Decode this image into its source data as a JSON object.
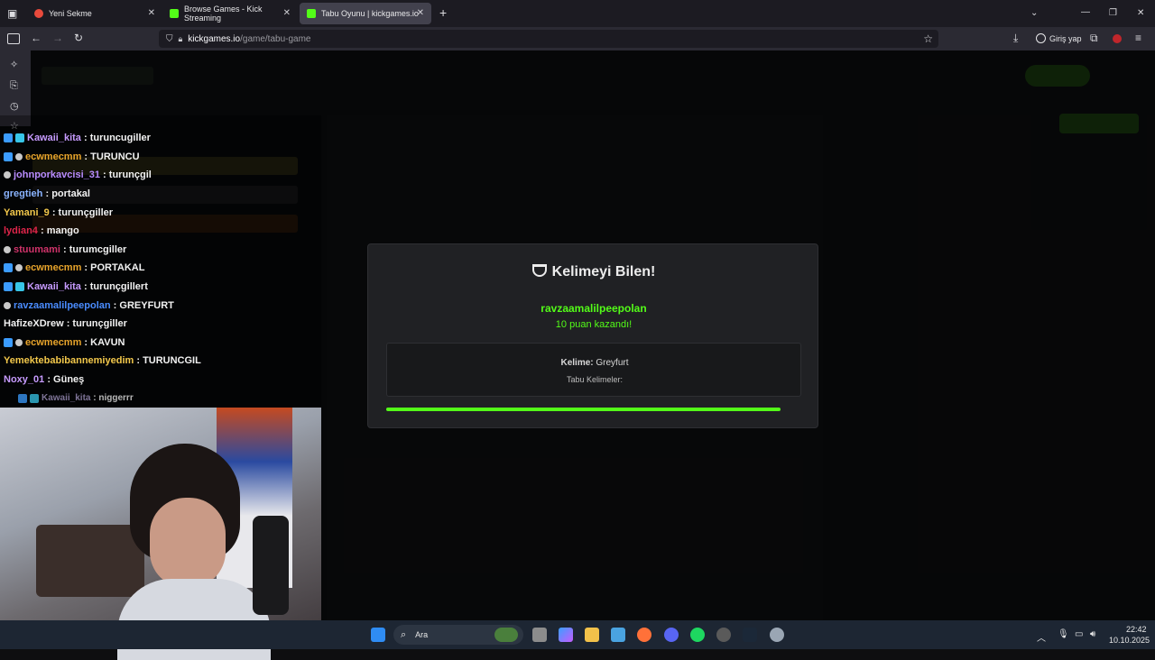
{
  "browser": {
    "tabs": [
      {
        "title": "Yeni Sekme",
        "active": false,
        "favicon_color": "#e84a3c"
      },
      {
        "title": "Browse Games - Kick Streaming",
        "active": false,
        "favicon_color": "#53fc18"
      },
      {
        "title": "Tabu Oyunu | kickgames.io",
        "active": true,
        "favicon_color": "#53fc18"
      }
    ],
    "url_host": "kickgames.io",
    "url_path": "/game/tabu-game",
    "signin_label": "Giriş yap"
  },
  "chat": {
    "messages": [
      {
        "user": "Kawaii_kita",
        "text": "turuncugiller",
        "color": "#c79bff",
        "badges": [
          "blue",
          "cube"
        ]
      },
      {
        "user": "ecwmecmm",
        "text": "TURUNCU",
        "color": "#e8a42b",
        "badges": [
          "blue",
          "gear"
        ]
      },
      {
        "user": "johnporkavcisi_31",
        "text": "turunçgil",
        "color": "#b98cff",
        "badges": [
          "gear"
        ]
      },
      {
        "user": "gregtieh",
        "text": "portakal",
        "color": "#8ab4ff",
        "badges": []
      },
      {
        "user": "Yamani_9",
        "text": "turunçgiller",
        "color": "#f3c84b",
        "badges": []
      },
      {
        "user": "lydian4",
        "text": "mango",
        "color": "#e0254a",
        "badges": []
      },
      {
        "user": "stuumami",
        "text": "turumcgiller",
        "color": "#d0336a",
        "badges": [
          "gear"
        ]
      },
      {
        "user": "ecwmecmm",
        "text": "PORTAKAL",
        "color": "#e8a42b",
        "badges": [
          "blue",
          "gear"
        ]
      },
      {
        "user": "Kawaii_kita",
        "text": "turunçgillert",
        "color": "#c79bff",
        "badges": [
          "blue",
          "cube"
        ]
      },
      {
        "user": "ravzaamalilpeepolan",
        "text": "GREYFURT",
        "color": "#4a8cff",
        "badges": [
          "gear"
        ]
      },
      {
        "user": "HafizeXDrew",
        "text": "turunçgiller",
        "color": "#f2f2f2",
        "badges": []
      },
      {
        "user": "ecwmecmm",
        "text": "KAVUN",
        "color": "#e8a42b",
        "badges": [
          "blue",
          "gear"
        ]
      },
      {
        "user": "Yemektebabibannemiyedim",
        "text": "TURUNCGIL",
        "color": "#f3c84b",
        "badges": []
      },
      {
        "user": "Noxy_01",
        "text": "Güneş",
        "color": "#c79bff",
        "badges": []
      },
      {
        "user": "Kawaii_kita",
        "text": "niggerrr",
        "color": "#a89ac8",
        "badges": [
          "blue",
          "cube"
        ]
      }
    ]
  },
  "modal": {
    "title": "Kelimeyi Bilen!",
    "winner": "ravzaamalilpeepolan",
    "points_text": "10 puan kazandı!",
    "word_label": "Kelime:",
    "word_value": "Greyfurt",
    "tabu_label": "Tabu Kelimeler:",
    "progress": 0.95
  },
  "taskbar": {
    "search_label": "Ara",
    "time": "22:42",
    "date": "10.10.2025"
  }
}
